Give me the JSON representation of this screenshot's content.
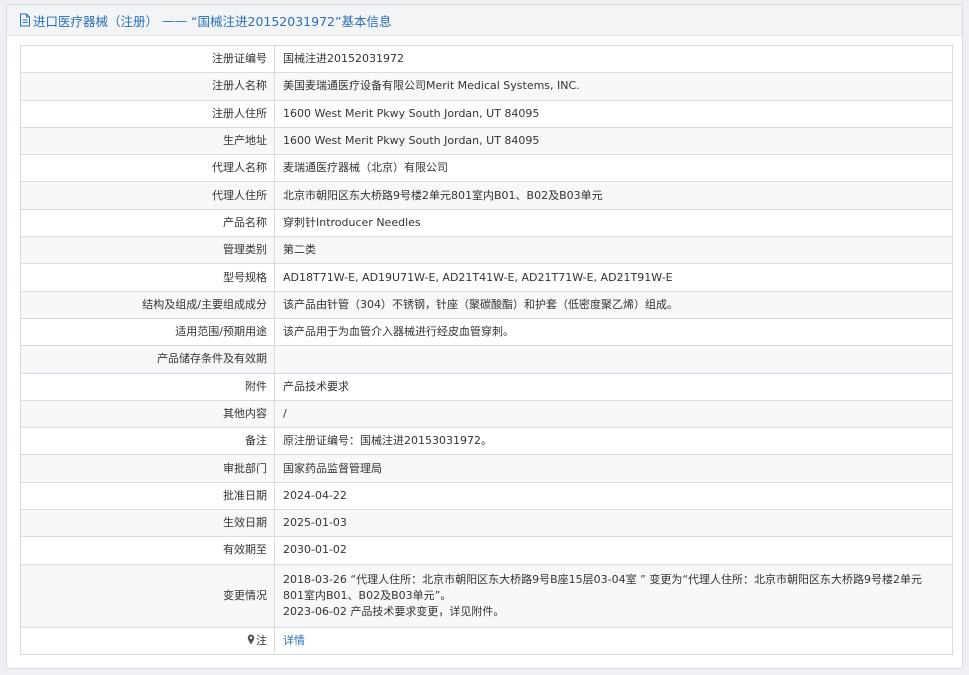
{
  "header": {
    "category": "进口医疗器械（注册）",
    "separator": "——",
    "reg_no_title": "“国械注进20152031972”基本信息"
  },
  "rows": [
    {
      "key": "注册证编号",
      "value": "国械注进20152031972"
    },
    {
      "key": "注册人名称",
      "value": "美国麦瑞通医疗设备有限公司Merit Medical Systems, INC."
    },
    {
      "key": "注册人住所",
      "value": "1600 West Merit Pkwy South Jordan, UT 84095"
    },
    {
      "key": "生产地址",
      "value": "1600 West Merit Pkwy South Jordan, UT 84095"
    },
    {
      "key": "代理人名称",
      "value": "麦瑞通医疗器械（北京）有限公司"
    },
    {
      "key": "代理人住所",
      "value": "北京市朝阳区东大桥路9号楼2单元801室内B01、B02及B03单元"
    },
    {
      "key": "产品名称",
      "value": "穿刺针Introducer Needles"
    },
    {
      "key": "管理类别",
      "value": "第二类"
    },
    {
      "key": "型号规格",
      "value": "AD18T71W-E, AD19U71W-E, AD21T41W-E, AD21T71W-E, AD21T91W-E"
    },
    {
      "key": "结构及组成/主要组成成分",
      "value": "该产品由针管（304）不锈钢，针座（聚碳酸酯）和护套（低密度聚乙烯）组成。"
    },
    {
      "key": "适用范围/预期用途",
      "value": "该产品用于为血管介入器械进行经皮血管穿刺。"
    },
    {
      "key": "产品储存条件及有效期",
      "value": ""
    },
    {
      "key": "附件",
      "value": "产品技术要求"
    },
    {
      "key": "其他内容",
      "value": "/"
    },
    {
      "key": "备注",
      "value": "原注册证编号：国械注进20153031972。"
    },
    {
      "key": "审批部门",
      "value": "国家药品监督管理局"
    },
    {
      "key": "批准日期",
      "value": "2024-04-22"
    },
    {
      "key": "生效日期",
      "value": "2025-01-03"
    },
    {
      "key": "有效期至",
      "value": "2030-01-02"
    }
  ],
  "change": {
    "key": "变更情况",
    "line1": "2018-03-26 “代理人住所：北京市朝阳区东大桥路9号B座15层03-04室 ” 变更为“代理人住所：北京市朝阳区东大桥路9号楼2单元",
    "line2": "801室内B01、B02及B03单元”。",
    "line3": "2023-06-02 产品技术要求变更，详见附件。"
  },
  "note": {
    "key": "注",
    "icon": "pin-icon",
    "link_text": "详情",
    "link_color": "#2a6fb7"
  }
}
